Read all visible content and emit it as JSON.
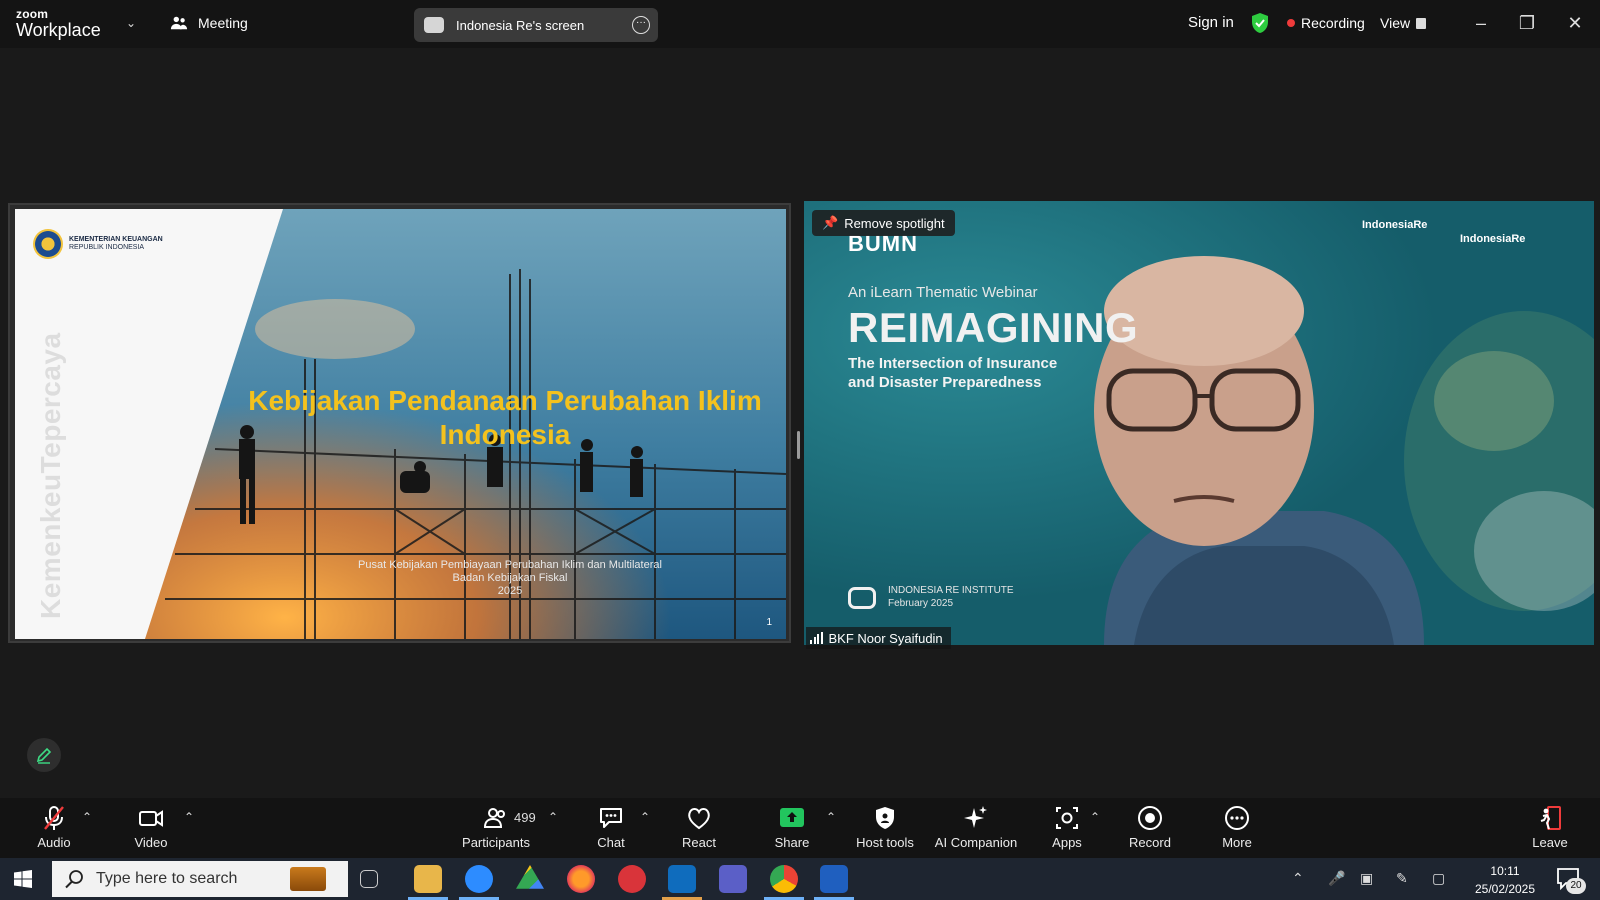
{
  "app": {
    "brand_small": "zoom",
    "brand_big": "Workplace",
    "meeting_label": "Meeting",
    "screen_share_label": "Indonesia Re's screen",
    "sign_in": "Sign in",
    "recording_label": "Recording",
    "view_label": "View"
  },
  "slide": {
    "ministry_line1": "KEMENTERIAN KEUANGAN",
    "ministry_line2": "REPUBLIK INDONESIA",
    "vertical_text": "KemenkeuTepercaya",
    "title_line1": "Kebijakan Pendanaan Perubahan Iklim",
    "title_line2": "Indonesia",
    "subtitle_line1": "Pusat Kebijakan Pembiayaan Perubahan Iklim dan Multilateral",
    "subtitle_line2": "Badan Kebijakan Fiskal",
    "subtitle_line3": "2025",
    "page_number": "1"
  },
  "video": {
    "bumn": "BUMN",
    "logo_right_1": "IndonesiaRe",
    "logo_right_2": "IndonesiaRe",
    "webinar": "An iLearn Thematic Webinar",
    "headline": "REIMAGINING",
    "intersect_line1": "The Intersection of Insurance",
    "intersect_line2": "and Disaster Preparedness",
    "institute_line1": "INDONESIA RE INSTITUTE",
    "institute_line2": "February 2025",
    "remove_spotlight": "Remove spotlight",
    "participant_name": "BKF Noor Syaifudin"
  },
  "toolbar": {
    "audio": "Audio",
    "video": "Video",
    "participants": "Participants",
    "participants_count": "499",
    "chat": "Chat",
    "react": "React",
    "share": "Share",
    "host_tools": "Host tools",
    "ai_companion": "AI Companion",
    "apps": "Apps",
    "record": "Record",
    "more": "More",
    "leave": "Leave"
  },
  "taskbar": {
    "search_placeholder": "Type here to search",
    "time": "10:11",
    "date": "25/02/2025",
    "notification_count": "20"
  },
  "colors": {
    "slide_title": "#f4c21d",
    "recording_dot": "#ef3b3b",
    "shield_green": "#2ecc40",
    "share_green": "#22c55e",
    "video_bg": "#1b6f7b"
  }
}
